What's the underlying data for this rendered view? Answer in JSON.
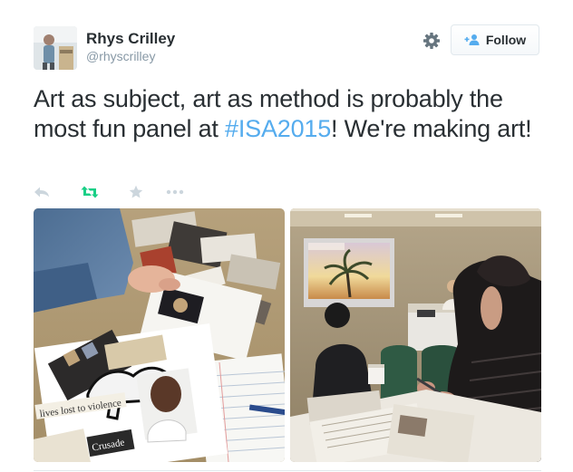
{
  "user": {
    "display_name": "Rhys Crilley",
    "handle": "@rhyscrilley",
    "avatar_icon": "avatar-photo"
  },
  "header": {
    "settings_icon": "gear-icon",
    "follow_label": "Follow",
    "follow_icon": "add-user-icon"
  },
  "tweet": {
    "text_before": "Art as subject, art as method is probably the most fun panel at ",
    "hashtag": "#ISA2015",
    "text_after": "! We're making art!"
  },
  "actions": {
    "icons": [
      "reply-icon",
      "retweet-icon",
      "favorite-icon",
      "more-icon"
    ],
    "retweet_color": "#19cf86",
    "muted_color": "#ccd6dd"
  },
  "media": {
    "photo_1": {
      "collage_text_1": "lives lost to violence",
      "collage_text_2": "Crusade"
    },
    "photo_2": {}
  },
  "colors": {
    "text": "#292f33",
    "link": "#55acee",
    "muted": "#8899a6",
    "border": "#e1e8ed"
  }
}
